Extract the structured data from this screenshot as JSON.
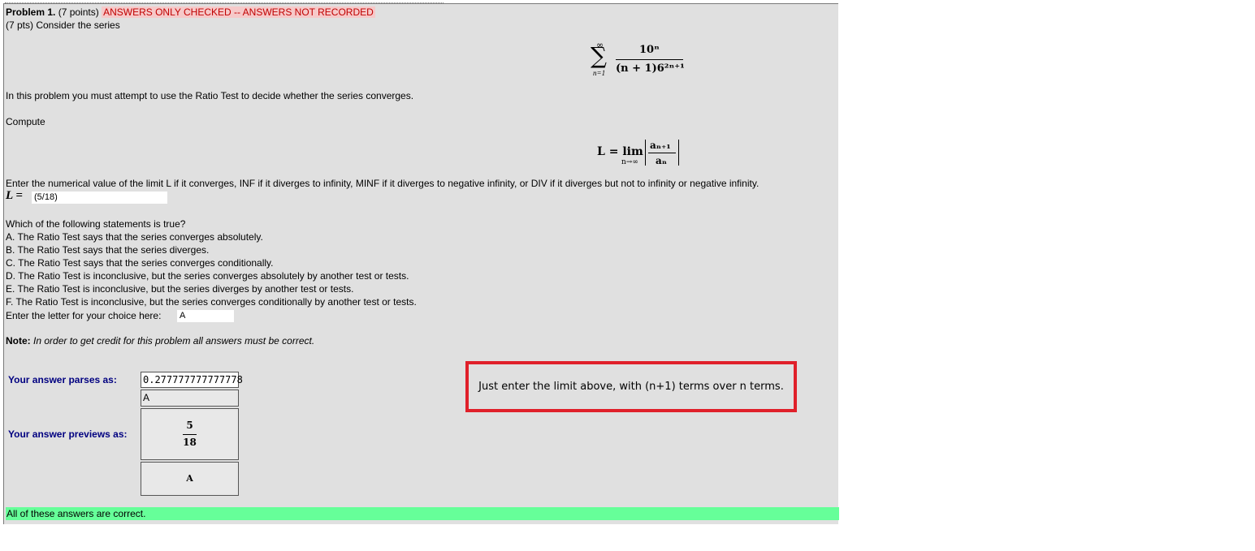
{
  "problem": {
    "number_label": "Problem 1.",
    "points": "(7 points)",
    "status": "ANSWERS ONLY CHECKED -- ANSWERS NOT RECORDED",
    "intro": "(7 pts) Consider the series"
  },
  "series_formula": {
    "sum_upper": "∞",
    "sum_lower": "n=1",
    "numerator": "10ⁿ",
    "denominator": "(n + 1)6²ⁿ⁺¹"
  },
  "text": {
    "instruction": "In this problem you must attempt to use the Ratio Test to decide whether the series converges.",
    "compute": "Compute",
    "enter_limit": "Enter the numerical value of the limit L if it converges, INF if it diverges to infinity, MINF if it diverges to negative infinity, or DIV if it diverges but not to infinity or negative infinity.",
    "question": "Which of the following statements is true?",
    "choice_prompt": "Enter the letter for your choice here:",
    "note_label": "Note:",
    "note_text": "In order to get credit for this problem all answers must be correct."
  },
  "limit_formula": {
    "lhs": "L = lim",
    "sub": "n→∞",
    "num": "aₙ₊₁",
    "den": "aₙ"
  },
  "choices": [
    "A. The Ratio Test says that the series converges absolutely.",
    "B. The Ratio Test says that the series diverges.",
    "C. The Ratio Test says that the series converges conditionally.",
    "D. The Ratio Test is inconclusive, but the series converges absolutely by another test or tests.",
    "E. The Ratio Test is inconclusive, but the series diverges by another test or tests.",
    "F. The Ratio Test is inconclusive, but the series converges conditionally by another test or tests."
  ],
  "inputs": {
    "l_label": "L =",
    "l_value": "(5/18)",
    "choice_value": "A"
  },
  "results": {
    "parses_label": "Your answer parses as:",
    "previews_label": "Your answer previews as:",
    "parsed_1": "0.277777777777778",
    "parsed_2": "A",
    "preview_num": "5",
    "preview_den": "18",
    "preview_2": "A",
    "correct_message": "All of these answers are correct."
  },
  "hint": "Just enter the limit above, with (n+1) terms over n terms.",
  "colors": {
    "status_text": "#c00000",
    "status_bg": "#f6c9c9",
    "correct_bg": "#66ff99",
    "label_blue": "#000080",
    "hint_border": "#e0202a"
  }
}
